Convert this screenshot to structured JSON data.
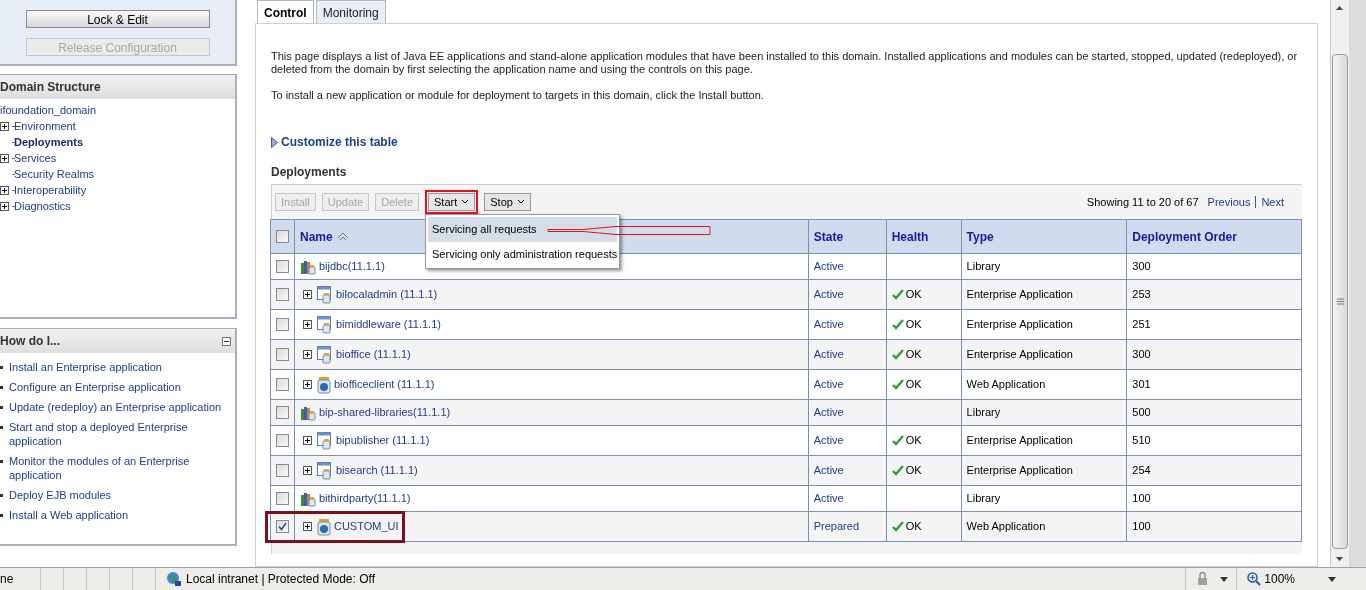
{
  "sidebar": {
    "change_center": {
      "buttons": [
        {
          "label": "Lock & Edit",
          "disabled": false
        },
        {
          "label": "Release Configuration",
          "disabled": true
        }
      ]
    },
    "domain_structure": {
      "title": "Domain Structure",
      "root": "ifoundation_domain",
      "items": [
        {
          "label": "Environment",
          "expandable": true,
          "selected": false
        },
        {
          "label": "Deployments",
          "expandable": false,
          "selected": true
        },
        {
          "label": "Services",
          "expandable": true,
          "selected": false
        },
        {
          "label": "Security Realms",
          "expandable": false,
          "selected": false
        },
        {
          "label": "Interoperability",
          "expandable": true,
          "selected": false
        },
        {
          "label": "Diagnostics",
          "expandable": true,
          "selected": false
        }
      ]
    },
    "how_do_i": {
      "title": "How do I...",
      "links": [
        "Install an Enterprise application",
        "Configure an Enterprise application",
        "Update (redeploy) an Enterprise application",
        "Start and stop a deployed Enterprise application",
        "Monitor the modules of an Enterprise application",
        "Deploy EJB modules",
        "Install a Web application"
      ]
    }
  },
  "tabs": [
    {
      "label": "Control",
      "selected": true
    },
    {
      "label": "Monitoring",
      "selected": false
    }
  ],
  "intro": [
    "This page displays a list of Java EE applications and stand-alone application modules that have been installed to this domain. Installed applications and modules can be started, stopped, updated (redeployed), or deleted from the domain by first selecting the application name and using the controls on this page.",
    "To install a new application or module for deployment to targets in this domain, click the Install button."
  ],
  "customize_link": "Customize this table",
  "section_title": "Deployments",
  "toolbar": [
    {
      "label": "Install",
      "disabled": true,
      "dropdown": false,
      "highlighted": false
    },
    {
      "label": "Update",
      "disabled": true,
      "dropdown": false,
      "highlighted": false
    },
    {
      "label": "Delete",
      "disabled": true,
      "dropdown": false,
      "highlighted": false
    },
    {
      "label": "Start",
      "disabled": false,
      "dropdown": true,
      "highlighted": true
    },
    {
      "label": "Stop",
      "disabled": false,
      "dropdown": true,
      "highlighted": false
    }
  ],
  "start_menu": [
    {
      "label": "Servicing all requests",
      "selected": true
    },
    {
      "label": "Servicing only administration requests",
      "selected": false
    }
  ],
  "pagination": {
    "summary": "Showing 11 to 20 of 67",
    "previous": "Previous",
    "next": "Next"
  },
  "table": {
    "header_checked": false,
    "columns": [
      "Name",
      "State",
      "Health",
      "Type",
      "Deployment Order"
    ],
    "rows": [
      {
        "name": "bijdbc(11.1.1)",
        "kind": "library",
        "expandable": false,
        "checked": false,
        "highlighted": false,
        "state": "Active",
        "health": "",
        "type": "Library",
        "order": "300"
      },
      {
        "name": "bilocaladmin (11.1.1)",
        "kind": "application",
        "expandable": true,
        "checked": false,
        "highlighted": false,
        "state": "Active",
        "health": "OK",
        "type": "Enterprise Application",
        "order": "253"
      },
      {
        "name": "bimiddleware (11.1.1)",
        "kind": "application",
        "expandable": true,
        "checked": false,
        "highlighted": false,
        "state": "Active",
        "health": "OK",
        "type": "Enterprise Application",
        "order": "251"
      },
      {
        "name": "bioffice (11.1.1)",
        "kind": "application",
        "expandable": true,
        "checked": false,
        "highlighted": false,
        "state": "Active",
        "health": "OK",
        "type": "Enterprise Application",
        "order": "300"
      },
      {
        "name": "biofficeclient (11.1.1)",
        "kind": "webapp",
        "expandable": true,
        "checked": false,
        "highlighted": false,
        "state": "Active",
        "health": "OK",
        "type": "Web Application",
        "order": "301"
      },
      {
        "name": "bip-shared-libraries(11.1.1)",
        "kind": "library",
        "expandable": false,
        "checked": false,
        "highlighted": false,
        "state": "Active",
        "health": "",
        "type": "Library",
        "order": "500"
      },
      {
        "name": "bipublisher (11.1.1)",
        "kind": "application",
        "expandable": true,
        "checked": false,
        "highlighted": false,
        "state": "Active",
        "health": "OK",
        "type": "Enterprise Application",
        "order": "510"
      },
      {
        "name": "bisearch (11.1.1)",
        "kind": "application",
        "expandable": true,
        "checked": false,
        "highlighted": false,
        "state": "Active",
        "health": "OK",
        "type": "Enterprise Application",
        "order": "254"
      },
      {
        "name": "bithirdparty(11.1.1)",
        "kind": "library",
        "expandable": false,
        "checked": false,
        "highlighted": false,
        "state": "Active",
        "health": "",
        "type": "Library",
        "order": "100"
      },
      {
        "name": "CUSTOM_UI",
        "kind": "webapp",
        "expandable": true,
        "checked": true,
        "highlighted": true,
        "state": "Prepared",
        "health": "OK",
        "type": "Web Application",
        "order": "100"
      }
    ]
  },
  "status_bar": {
    "text": "ne",
    "zone": "Local intranet | Protected Mode: Off",
    "zoom": "100%"
  }
}
